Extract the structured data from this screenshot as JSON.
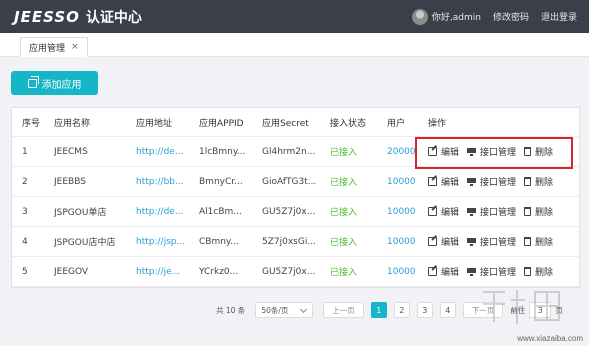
{
  "header": {
    "logo": "JEESSO",
    "logo_sub": "认证中心",
    "greeting": "你好,admin",
    "change_password": "修改密码",
    "logout": "退出登录"
  },
  "tabs": [
    {
      "label": "应用管理",
      "close": "×"
    }
  ],
  "toolbar": {
    "add_label": "添加应用"
  },
  "table": {
    "columns": [
      "序号",
      "应用名称",
      "应用地址",
      "应用APPID",
      "应用Secret",
      "接入状态",
      "用户",
      "操作"
    ],
    "rows": [
      {
        "idx": "1",
        "name": "JEECMS",
        "url": "http://de...",
        "appid": "1lcBmny...",
        "secret": "Gl4hrm2n...",
        "status": "已接入",
        "users": "20000"
      },
      {
        "idx": "2",
        "name": "JEEBBS",
        "url": "http://bb...",
        "appid": "BmnyCr...",
        "secret": "GioAfTG3t...",
        "status": "已接入",
        "users": "10000"
      },
      {
        "idx": "3",
        "name": "JSPGOU单店",
        "url": "http://de...",
        "appid": "Al1cBm...",
        "secret": "GU5Z7j0x...",
        "status": "已接入",
        "users": "10000"
      },
      {
        "idx": "4",
        "name": "JSPGOU店中店",
        "url": "http://jsp...",
        "appid": "CBmny...",
        "secret": "5Z7j0xsGi...",
        "status": "已接入",
        "users": "10000"
      },
      {
        "idx": "5",
        "name": "JEEGOV",
        "url": "http://je...",
        "appid": "YCrkz0...",
        "secret": "GU5Z7j0x...",
        "status": "已接入",
        "users": "10000"
      }
    ],
    "ops": {
      "edit": "编辑",
      "api": "接口管理",
      "delete": "删除"
    }
  },
  "pagination": {
    "total": "共 10 条",
    "page_size": "50条/页",
    "prev": "上一页",
    "pages": [
      "1",
      "2",
      "3",
      "4"
    ],
    "current": "1",
    "next": "下一页",
    "goto_label": "前往",
    "goto_value": "3",
    "goto_suffix": "页"
  },
  "watermark": {
    "text": "www.xiazaiba.com"
  },
  "colors": {
    "header_bg": "#3a3f4a",
    "accent": "#16b5c8",
    "link": "#2a9fd6",
    "status_ok": "#4cba2f",
    "highlight": "#d9242b"
  }
}
